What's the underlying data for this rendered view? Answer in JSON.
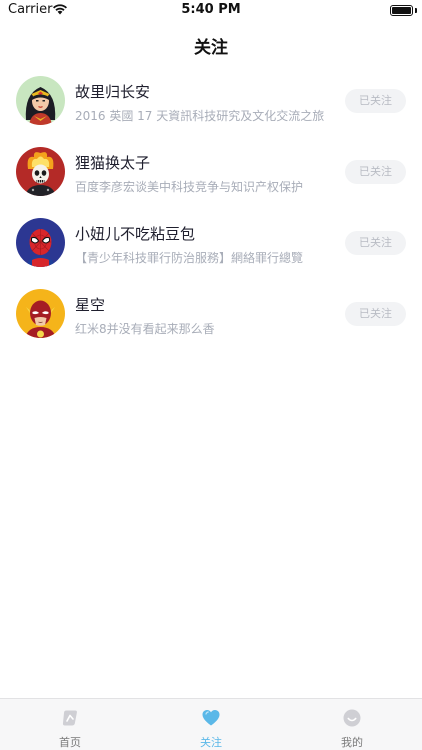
{
  "status_bar": {
    "carrier": "Carrier",
    "time": "5:40 PM"
  },
  "nav": {
    "title": "关注"
  },
  "follow_list": [
    {
      "name": "故里归长安",
      "desc": "2016 英國 17 天資訊科技研究及文化交流之旅",
      "button": "已关注",
      "avatar": "wonder-woman-avatar"
    },
    {
      "name": "狸猫换太子",
      "desc": "百度李彦宏谈美中科技竞争与知识产权保护",
      "button": "已关注",
      "avatar": "ghost-rider-avatar"
    },
    {
      "name": "小妞儿不吃粘豆包",
      "desc": "【青少年科技罪行防治服務】網絡罪行總覽",
      "button": "已关注",
      "avatar": "spider-man-avatar"
    },
    {
      "name": "星空",
      "desc": "红米8并没有看起来那么香",
      "button": "已关注",
      "avatar": "flash-avatar"
    }
  ],
  "tab_bar": {
    "tabs": [
      {
        "label": "首页",
        "icon": "home-icon",
        "active": false
      },
      {
        "label": "关注",
        "icon": "heart-icon",
        "active": true
      },
      {
        "label": "我的",
        "icon": "smile-icon",
        "active": false
      }
    ],
    "active_color": "#5bb8e8",
    "inactive_color": "#cfcfd4"
  }
}
